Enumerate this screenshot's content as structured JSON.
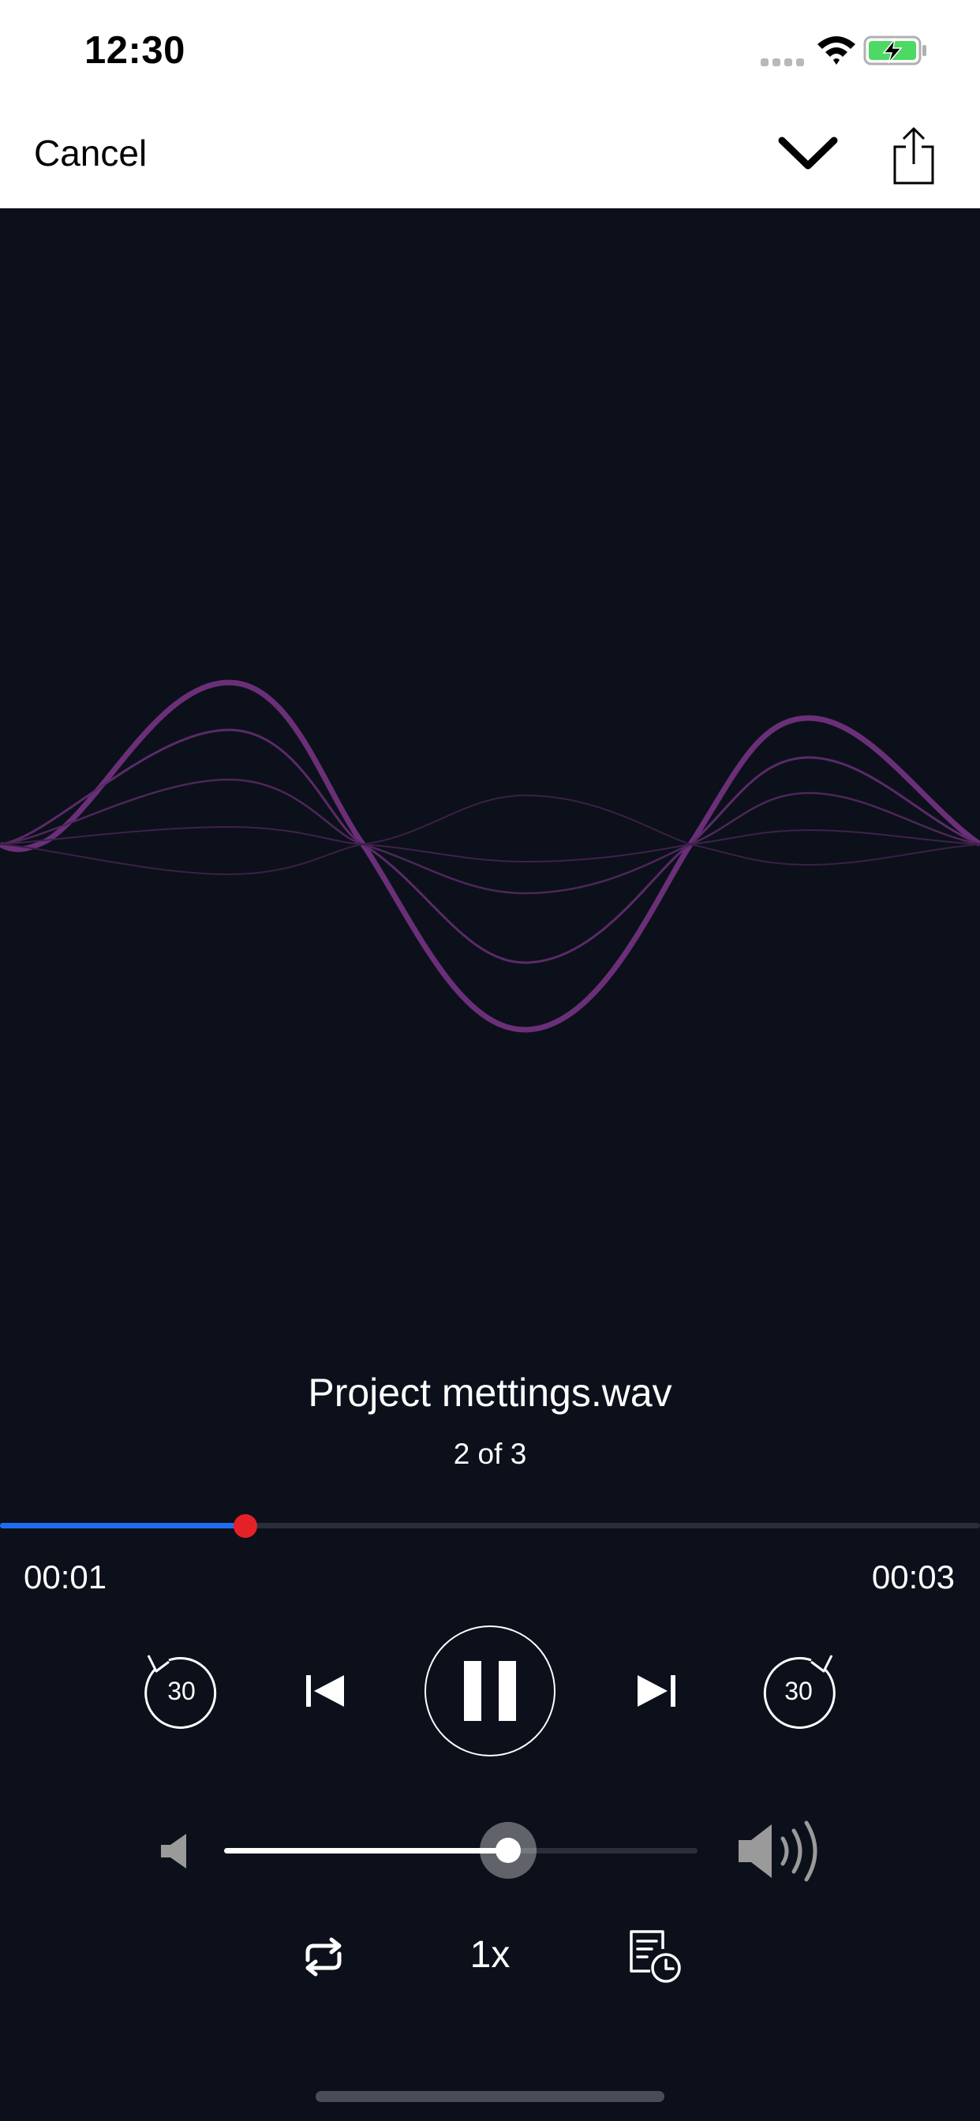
{
  "status_bar": {
    "time": "12:30"
  },
  "nav": {
    "cancel_label": "Cancel"
  },
  "track": {
    "title": "Project mettings.wav",
    "position": "2 of 3",
    "elapsed": "00:01",
    "duration": "00:03",
    "progress_fraction": 0.25
  },
  "controls": {
    "skip_back_seconds": "30",
    "skip_forward_seconds": "30",
    "speed": "1x",
    "volume_fraction": 0.6
  },
  "colors": {
    "background": "#0c101b",
    "wave": "#6b2f78",
    "progress": "#1f6ef0",
    "progress_thumb": "#e52128"
  },
  "icons": [
    "wifi-icon",
    "battery-charging-icon",
    "chevron-down-icon",
    "share-icon",
    "replay-30-icon",
    "previous-track-icon",
    "pause-icon",
    "next-track-icon",
    "forward-30-icon",
    "volume-low-icon",
    "volume-high-icon",
    "repeat-icon",
    "sleep-timer-icon"
  ]
}
